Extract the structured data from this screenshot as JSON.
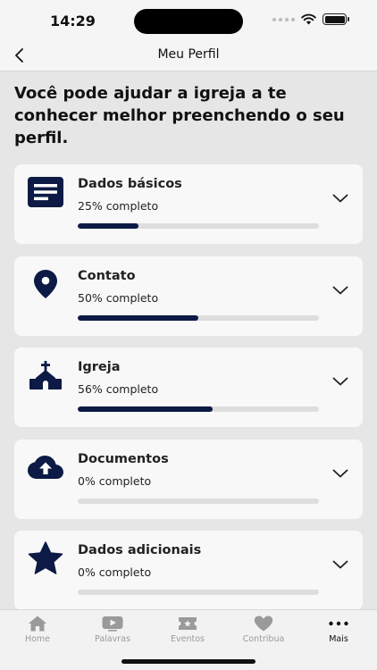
{
  "status_bar": {
    "time": "14:29"
  },
  "nav": {
    "title": "Meu Perfil"
  },
  "intro": "Você pode ajudar a igreja a te conhecer melhor preenchendo o seu perfil.",
  "sections": [
    {
      "title": "Dados básicos",
      "progress_label": "25% completo",
      "progress": 0.25,
      "icon": "document-icon"
    },
    {
      "title": "Contato",
      "progress_label": "50% completo",
      "progress": 0.5,
      "icon": "map-pin-icon"
    },
    {
      "title": "Igreja",
      "progress_label": "56% completo",
      "progress": 0.56,
      "icon": "church-icon"
    },
    {
      "title": "Documentos",
      "progress_label": "0% completo",
      "progress": 0,
      "icon": "cloud-upload-icon"
    },
    {
      "title": "Dados adicionais",
      "progress_label": "0% completo",
      "progress": 0,
      "icon": "star-icon"
    }
  ],
  "tabs": [
    {
      "label": "Home",
      "icon": "home-icon",
      "active": false
    },
    {
      "label": "Palavras",
      "icon": "play-icon",
      "active": false
    },
    {
      "label": "Eventos",
      "icon": "ticket-icon",
      "active": false
    },
    {
      "label": "Contribua",
      "icon": "heart-icon",
      "active": false
    },
    {
      "label": "Mais",
      "icon": "more-icon",
      "active": true
    }
  ],
  "colors": {
    "accent": "#0c1a45",
    "track": "#dedede",
    "card": "#f8f8f8",
    "background": "#e6e6e6"
  }
}
